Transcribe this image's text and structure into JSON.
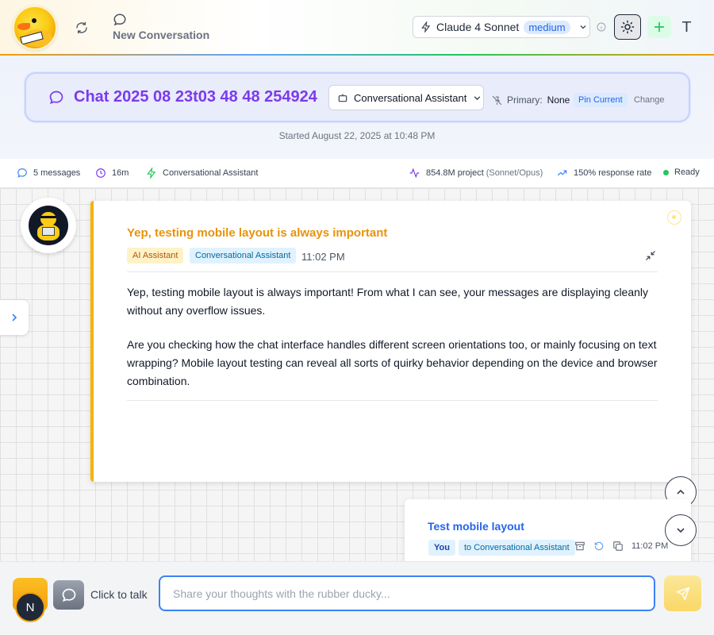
{
  "topbar": {
    "new_conversation_label": "New Conversation",
    "model_name": "Claude 4 Sonnet",
    "model_level": "medium"
  },
  "chat_header": {
    "title": "Chat 2025 08 23t03 48 48 254924",
    "assistant_select": "Conversational Assistant",
    "primary_label": "Primary:",
    "primary_value": "None",
    "pin_current": "Pin Current",
    "change": "Change",
    "started": "Started August 22, 2025 at 10:48 PM"
  },
  "stats": {
    "messages": "5 messages",
    "duration": "16m",
    "assistant": "Conversational Assistant",
    "tokens": "854.8M project",
    "tokens_models": "(Sonnet/Opus)",
    "response_rate": "150% response rate",
    "status": "Ready"
  },
  "assistant_message": {
    "title": "Yep, testing mobile layout is always important",
    "role_badge": "AI Assistant",
    "assistant_badge": "Conversational Assistant",
    "time": "11:02 PM",
    "paragraphs": [
      "Yep, testing mobile layout is always important! From what I can see, your messages are displaying cleanly without any overflow issues.",
      "Are you checking how the chat interface handles different screen orientations too, or mainly focusing on text wrapping? Mobile layout testing can reveal all sorts of quirky behavior depending on the device and browser combination."
    ]
  },
  "user_message": {
    "title": "Test mobile layout",
    "role_badge": "You",
    "to_badge": "to Conversational Assistant",
    "time": "11:02 PM"
  },
  "composer": {
    "talk_label": "Click to talk",
    "placeholder": "Share your thoughts with the rubber ducky...",
    "value": "",
    "avatar_initial": "N"
  },
  "colors": {
    "accent_purple": "#7c3aed",
    "assistant_orange": "#e8930c",
    "user_blue": "#2563eb",
    "input_border": "#3b82f6",
    "ready_green": "#22c55e"
  },
  "icons": [
    "refresh-icon",
    "chat-bubble-icon",
    "lightning-icon",
    "chevron-down-icon",
    "info-icon",
    "sun-icon",
    "plus-icon",
    "text-format-icon",
    "robot-icon",
    "pin-off-icon",
    "clock-icon",
    "activity-icon",
    "trending-up-icon",
    "chevron-right-icon",
    "collapse-icon",
    "archive-icon",
    "undo-icon",
    "copy-icon",
    "chevron-up-icon",
    "send-icon"
  ]
}
